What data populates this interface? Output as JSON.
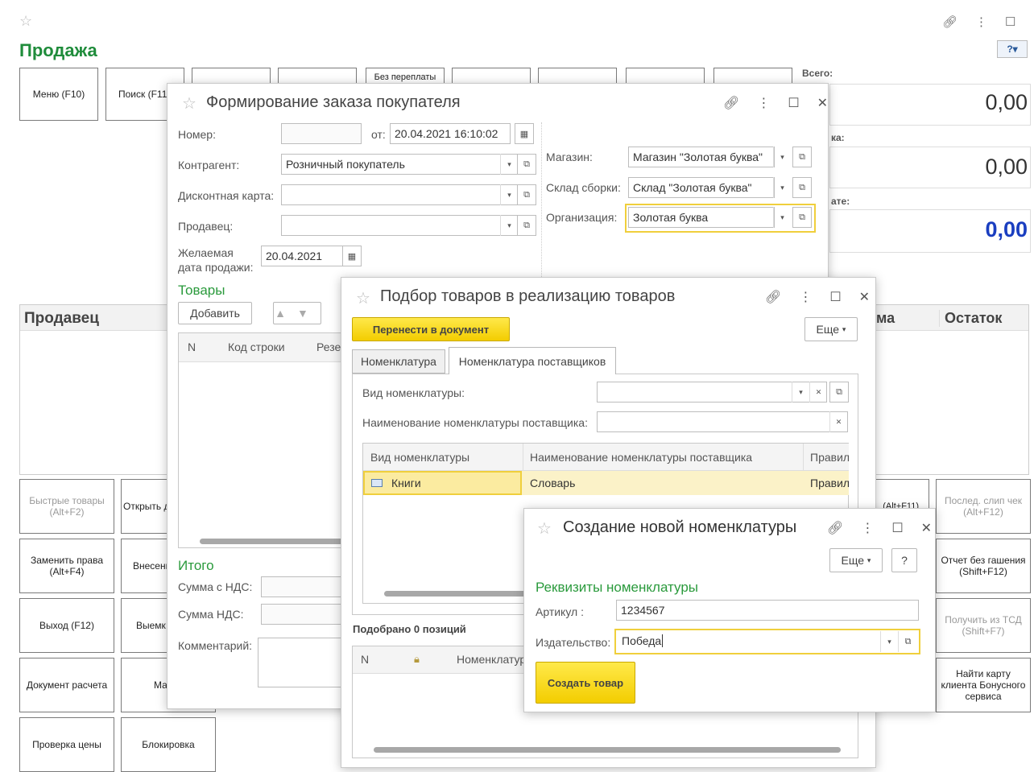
{
  "main": {
    "title": "Продажа",
    "top_buttons": [
      "Меню (F10)",
      "Поиск (F11",
      "Без переплаты"
    ],
    "totals": {
      "total_label": "Всего:",
      "total_value": "0,00",
      "discount_label_tail": "ка:",
      "discount_value": "0,00",
      "to_pay_label_tail": "ате:",
      "to_pay_value": "0,00"
    },
    "seller_label": "Продавец",
    "col_ma": "ма",
    "col_ostatok": "Остаток",
    "left_buttons": [
      "Быстрые товары (Alt+F2)",
      "Заменить права (Alt+F4)",
      "Выход (F12)",
      "Документ расчета",
      "Проверка цены"
    ],
    "mid_buttons": [
      "Открыть д",
      "Внесени (Alt",
      "Выемк (Ctr",
      "Ма",
      "Блокировка"
    ],
    "right_buttons": [
      "(Alt+F11)",
      "Послед. слип чек (Alt+F12)",
      "Отчет без гашения (Shift+F12)",
      "Получить из ТСД (Shift+F7)",
      "Найти карту клиента Бонусного сервиса"
    ]
  },
  "order": {
    "title": "Формирование заказа покупателя",
    "nomer_label": "Номер:",
    "ot_label": "от:",
    "date_value": "20.04.2021 16:10:02",
    "kontragent_label": "Контрагент:",
    "kontragent_value": "Розничный покупатель",
    "card_label": "Дисконтная карта:",
    "seller_label": "Продавец:",
    "desired_label_1": "Желаемая",
    "desired_label_2": "дата продажи:",
    "desired_value": "20.04.2021",
    "shop_label": "Магазин:",
    "shop_value": "Магазин \"Золотая буква\"",
    "warehouse_label": "Склад сборки:",
    "warehouse_value": "Склад \"Золотая буква\"",
    "org_label": "Организация:",
    "org_value": "Золотая буква",
    "goods_title": "Товары",
    "add_button": "Добавить",
    "cols": [
      "N",
      "Код строки",
      "Резе"
    ],
    "itogo_title": "Итого",
    "sum_vat_label": "Сумма с НДС:",
    "vat_label": "Сумма НДС:",
    "comment_label": "Комментарий:"
  },
  "picker": {
    "title": "Подбор товаров в реализацию товаров",
    "transfer_button": "Перенести в документ",
    "more_button": "Еще",
    "tabs": [
      "Номенклатура",
      "Номенклатура поставщиков"
    ],
    "kind_label": "Вид номенклатуры:",
    "name_label": "Наименование номенклатуры поставщика:",
    "cols": [
      "Вид номенклатуры",
      "Наименование номенклатуры поставщика",
      "Правил"
    ],
    "row": {
      "kind": "Книги",
      "name": "Словарь",
      "rule": "Правил"
    },
    "selected_count": "Подобрано 0 позиций",
    "bottom_cols": [
      "N",
      "Номенклатур"
    ]
  },
  "create": {
    "title": "Создание новой номенклатуры",
    "more_button": "Еще",
    "help_button": "?",
    "section": "Реквизиты номенклатуры",
    "article_label": "Артикул :",
    "article_value": "1234567",
    "publisher_label": "Издательство:",
    "publisher_value": "Победа",
    "create_button": "Создать товар"
  }
}
